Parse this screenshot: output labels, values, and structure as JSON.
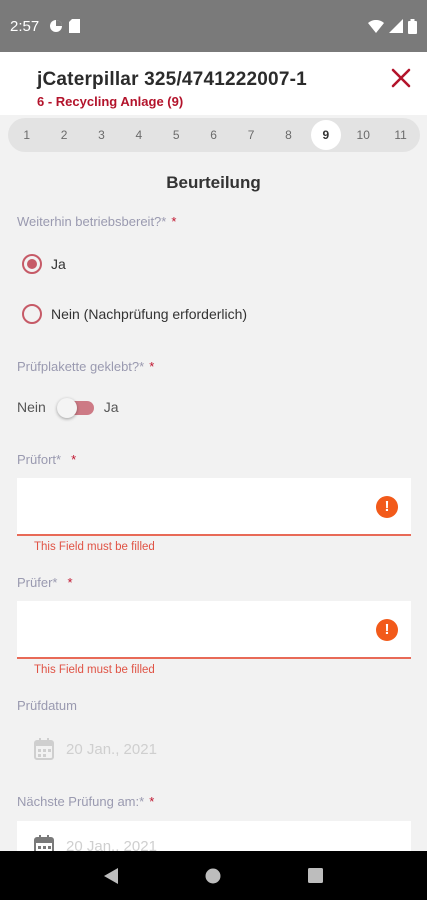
{
  "status_bar": {
    "time": "2:57"
  },
  "header": {
    "title": "jCaterpillar 325/4741222007-1",
    "subtitle": "6 - Recycling Anlage (9)"
  },
  "stepper": {
    "steps": [
      "1",
      "2",
      "3",
      "4",
      "5",
      "6",
      "7",
      "8",
      "9",
      "10",
      "11"
    ],
    "active_step": "9"
  },
  "form": {
    "section_title": "Beurteilung",
    "q1": {
      "label": "Weiterhin betriebsbereit?*",
      "required_mark": "*",
      "options": [
        "Ja",
        "Nein (Nachprüfung erforderlich)"
      ],
      "selected": "Ja"
    },
    "q2": {
      "label": "Prüfplakette geklebt?*",
      "required_mark": "*",
      "off_label": "Nein",
      "on_label": "Ja"
    },
    "pruefort": {
      "label": "Prüfort*",
      "required_mark": "*",
      "value": "",
      "error": "This Field must be filled"
    },
    "pruefer": {
      "label": "Prüfer*",
      "required_mark": "*",
      "value": "",
      "error": "This Field must be filled"
    },
    "pruefdatum": {
      "label": "Prüfdatum",
      "value": "20 Jan., 2021"
    },
    "naechste": {
      "label": "Nächste Prüfung am:*",
      "required_mark": "*",
      "value": "20 Jan., 2021"
    }
  },
  "colors": {
    "accent": "#b3132b",
    "radio": "#c65a67",
    "error": "#e86a57",
    "status_bar": "#7a7a7a"
  }
}
